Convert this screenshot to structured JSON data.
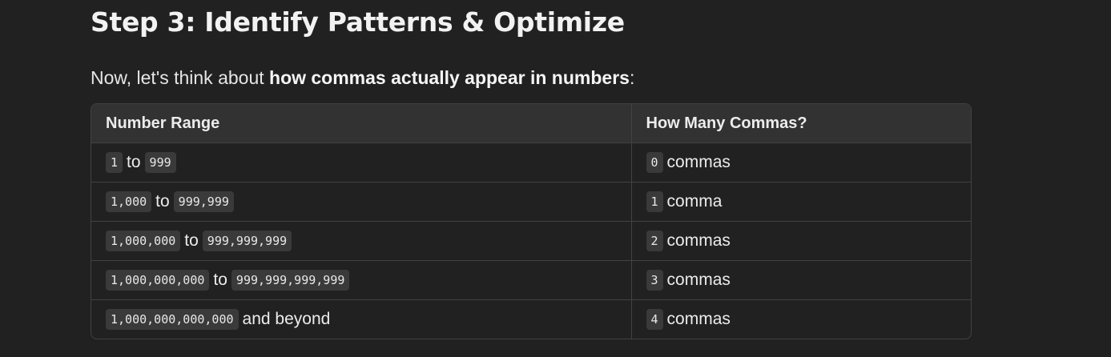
{
  "heading": "Step 3: Identify Patterns & Optimize",
  "intro": {
    "prefix": "Now, let's think about ",
    "bold": "how commas actually appear in numbers",
    "suffix": ":"
  },
  "table": {
    "headers": [
      "Number Range",
      "How Many Commas?"
    ],
    "rows": [
      {
        "from": "1",
        "connector": "to",
        "to": "999",
        "count": "0",
        "unit": "commas"
      },
      {
        "from": "1,000",
        "connector": "to",
        "to": "999,999",
        "count": "1",
        "unit": "comma"
      },
      {
        "from": "1,000,000",
        "connector": "to",
        "to": "999,999,999",
        "count": "2",
        "unit": "commas"
      },
      {
        "from": "1,000,000,000",
        "connector": "to",
        "to": "999,999,999,999",
        "count": "3",
        "unit": "commas"
      },
      {
        "from": "1,000,000,000,000",
        "connector": "and beyond",
        "to": null,
        "count": "4",
        "unit": "commas"
      }
    ]
  }
}
